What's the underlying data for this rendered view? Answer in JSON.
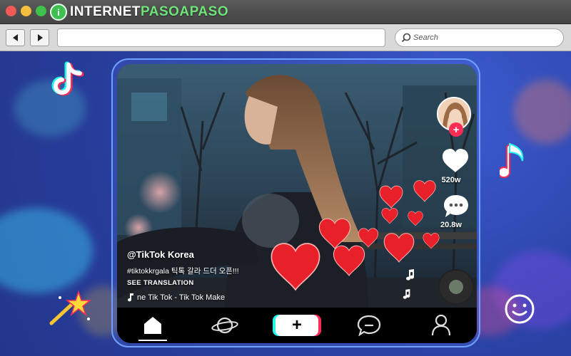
{
  "window": {
    "brand": {
      "logo_letter": "i",
      "name_part1": "INTERNET",
      "name_part2": "PASOAPASO"
    }
  },
  "toolbar": {
    "back_icon": "back-arrow-icon",
    "forward_icon": "forward-arrow-icon",
    "url_value": "",
    "search_label": "Search"
  },
  "post": {
    "username": "@TikTok Korea",
    "caption": "#tiktokkrgala 틱톡 갈라 드더 오픈!!!",
    "see_translation": "SEE TRANSLATION",
    "music": "ne Tik Tok - Tik Tok   Make",
    "likes": "520w",
    "comments": "20.8w",
    "follow_symbol": "+"
  },
  "bottom_nav": {
    "items": [
      {
        "name": "home",
        "icon": "home-icon",
        "active": true
      },
      {
        "name": "discover",
        "icon": "planet-icon",
        "active": false
      },
      {
        "name": "create",
        "icon": "plus-icon",
        "label": "+",
        "active": false
      },
      {
        "name": "inbox",
        "icon": "chat-bubble-icon",
        "active": false
      },
      {
        "name": "profile",
        "icon": "user-icon",
        "active": false
      }
    ]
  },
  "colors": {
    "tiktok_cyan": "#25f4ee",
    "tiktok_red": "#fe2c55",
    "heart_red": "#e8202a",
    "background_blue": "#2b44a8",
    "brand_green": "#3fbf4f"
  }
}
